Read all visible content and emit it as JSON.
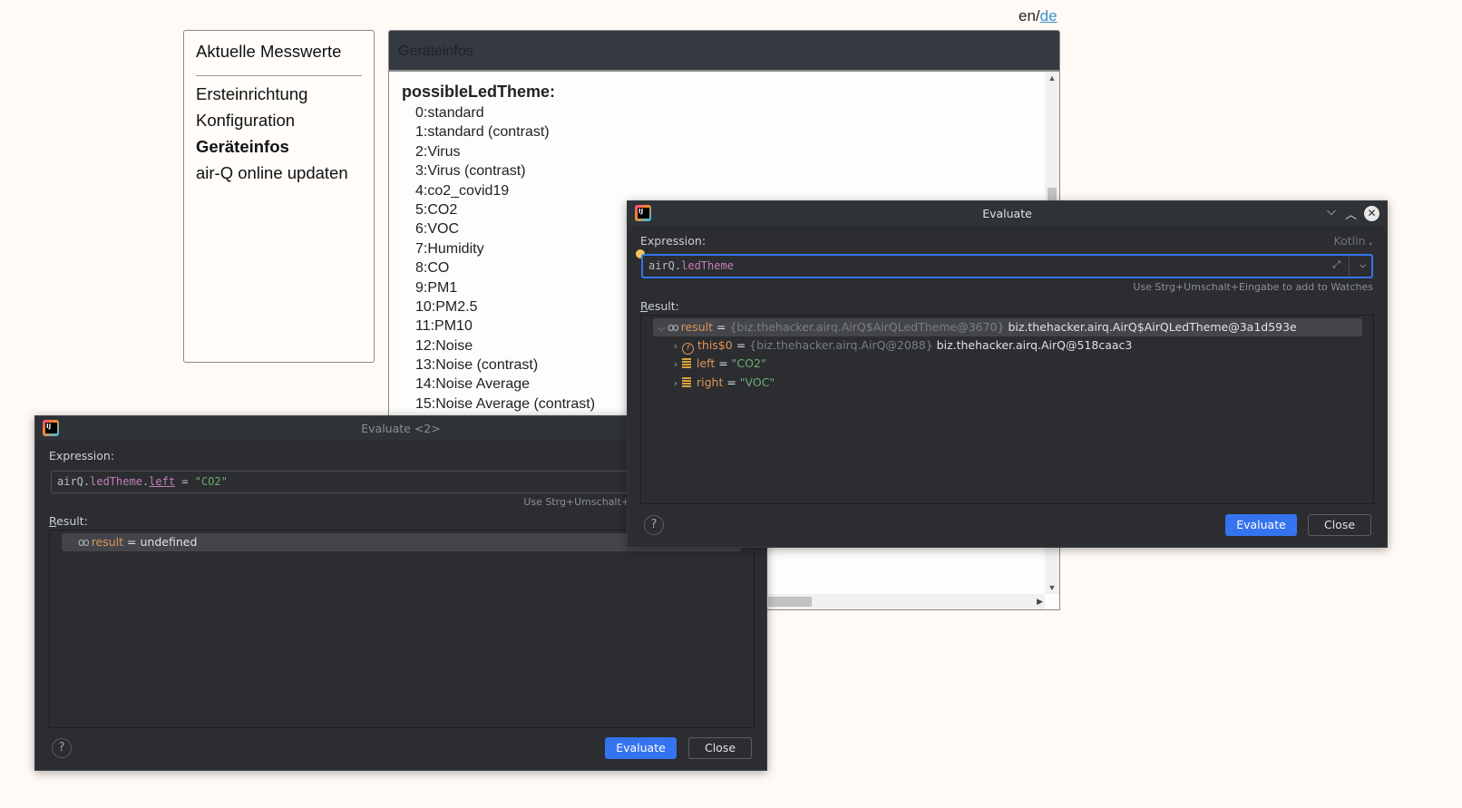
{
  "page": {
    "lang": {
      "en": "en/",
      "de": "de"
    },
    "nav": {
      "items": [
        {
          "label": "Aktuelle Messwerte",
          "active": false
        },
        {
          "label": "Ersteinrichtung",
          "active": false
        },
        {
          "label": "Konfiguration",
          "active": false
        },
        {
          "label": "Geräteinfos",
          "active": true
        },
        {
          "label": "air-Q online updaten",
          "active": false
        }
      ]
    },
    "info_panel": {
      "header": "Geräteinfos",
      "section_title": "possibleLedTheme:",
      "themes": [
        "0:standard",
        "1:standard (contrast)",
        "2:Virus",
        "3:Virus (contrast)",
        "4:co2_covid19",
        "5:CO2",
        "6:VOC",
        "7:Humidity",
        "8:CO",
        "9:PM1",
        "10:PM2.5",
        "11:PM10",
        "12:Noise",
        "13:Noise (contrast)",
        "14:Noise Average",
        "15:Noise Average (contrast)"
      ]
    }
  },
  "dialog_back": {
    "title": "Evaluate <2>",
    "expression_label": "Expression:",
    "expression": {
      "obj": "airQ.",
      "prop": "ledTheme",
      "dot": ".",
      "field": "left",
      "op": " = ",
      "value": "\"CO2\""
    },
    "hint": "Use Strg+Umschalt+",
    "result_label_u": "R",
    "result_label_rest": "esult:",
    "result_row": {
      "name": "result",
      "eq": " = ",
      "value": "undefined"
    },
    "evaluate_label": "Evaluate",
    "close_label": "Close",
    "help": "?"
  },
  "dialog_front": {
    "title": "Evaluate",
    "expression_label": "Expression:",
    "language": "Kotlin",
    "expression": {
      "obj": "airQ.",
      "prop": "ledTheme"
    },
    "hint": "Use Strg+Umschalt+Eingabe to add to Watches",
    "result_label_u": "R",
    "result_label_rest": "esult:",
    "tree": [
      {
        "name": "result",
        "eq": " = ",
        "type": "{biz.thehacker.airq.AirQ$AirQLedTheme@3670}",
        "value": " biz.thehacker.airq.AirQ$AirQLedTheme@3a1d593e",
        "expanded": true
      },
      {
        "name": "this$0",
        "eq": " = ",
        "type": "{biz.thehacker.airq.AirQ@2088}",
        "value": " biz.thehacker.airq.AirQ@518caac3"
      },
      {
        "name": "left",
        "eq": " = ",
        "value": "\"CO2\""
      },
      {
        "name": "right",
        "eq": " = ",
        "value": "\"VOC\""
      }
    ],
    "evaluate_label": "Evaluate",
    "close_label": "Close",
    "help": "?"
  }
}
